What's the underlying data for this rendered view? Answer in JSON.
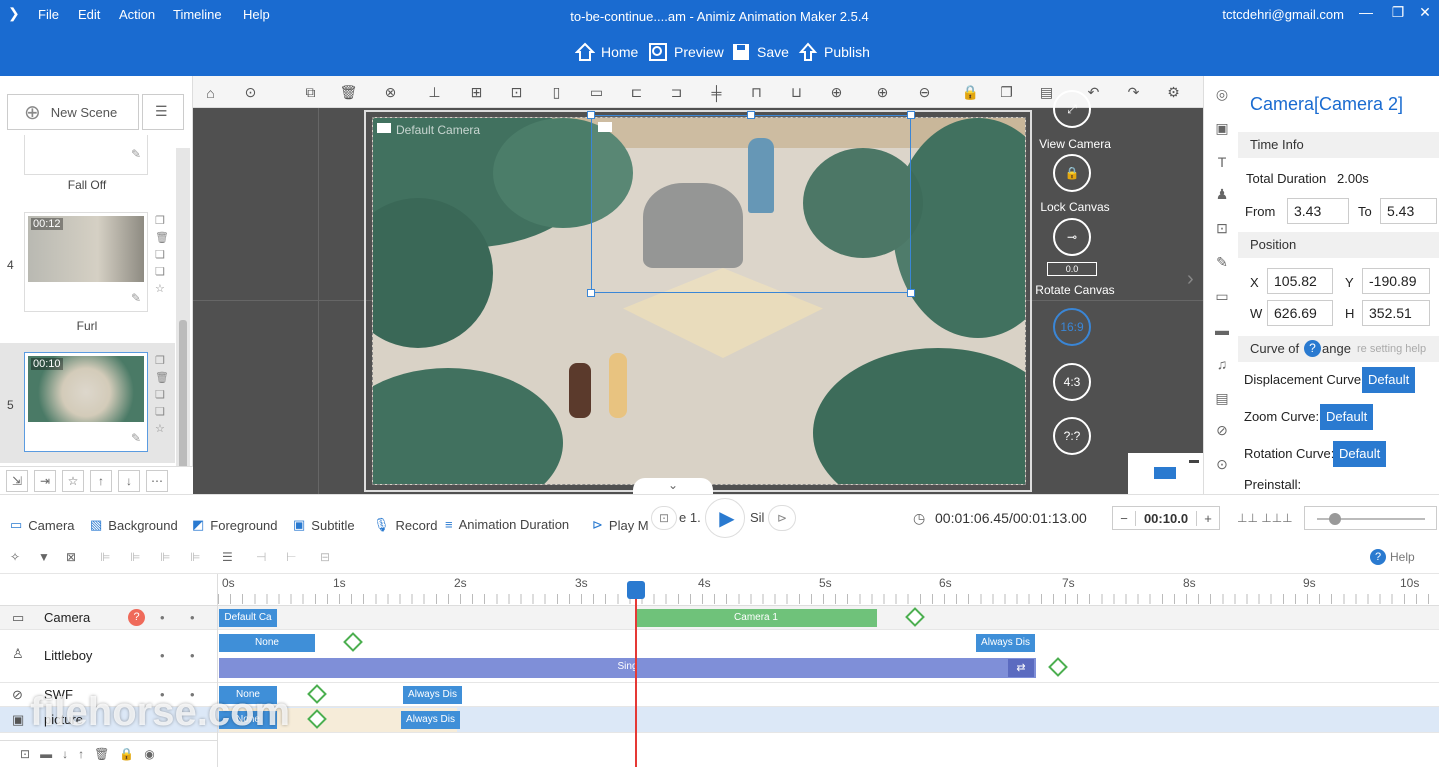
{
  "window": {
    "title": "to-be-continue....am - Animiz Animation Maker 2.5.4",
    "user": "tctcdehri@gmail.com"
  },
  "menu": [
    "File",
    "Edit",
    "Action",
    "Timeline",
    "Help"
  ],
  "top_actions": {
    "home": "Home",
    "preview": "Preview",
    "save": "Save",
    "publish": "Publish"
  },
  "scenes": {
    "new_scene": "New Scene",
    "items": [
      {
        "number": "",
        "name": "Fall Off",
        "time": ""
      },
      {
        "number": "4",
        "name": "Furl",
        "time": "00:12"
      },
      {
        "number": "5",
        "name": "",
        "time": "00:10"
      }
    ]
  },
  "canvas": {
    "default_camera_label": "Default Camera"
  },
  "canvas_controls": {
    "view_camera": "View Camera",
    "lock_canvas": "Lock Canvas",
    "rotate_value": "0.0",
    "rotate_canvas": "Rotate Canvas",
    "ratio_16_9": "16:9",
    "ratio_4_3": "4:3",
    "ratio_custom": "?:?"
  },
  "properties": {
    "title": "Camera[Camera 2]",
    "time_info": "Time Info",
    "total_duration_label": "Total Duration",
    "total_duration": "2.00s",
    "from_label": "From",
    "from": "3.43",
    "to_label": "To",
    "to": "5.43",
    "position": "Position",
    "x_label": "X",
    "x": "105.82",
    "y_label": "Y",
    "y": "-190.89",
    "w_label": "W",
    "w": "626.69",
    "h_label": "H",
    "h": "352.51",
    "curve_label": "Curve of",
    "curve_label_end": "ange",
    "curve_help": "re setting help",
    "displacement_curve": "Displacement Curve:",
    "zoom_curve": "Zoom Curve:",
    "rotation_curve": "Rotation Curve:",
    "default_btn": "Default",
    "preinstall": "Preinstall:"
  },
  "timeline_toolbar": {
    "camera": "Camera",
    "background": "Background",
    "foreground": "Foreground",
    "subtitle": "Subtitle",
    "record": "Record",
    "animation_duration": "Animation Duration",
    "play_mode": "Play M",
    "play_mode_end": "e 1.",
    "sil": "Sil",
    "timecode": "00:01:06.45/00:01:13.00",
    "zoom": "00:10.0",
    "help": "Help"
  },
  "ruler": [
    "0s",
    "1s",
    "2s",
    "3s",
    "4s",
    "5s",
    "6s",
    "7s",
    "8s",
    "9s",
    "10s"
  ],
  "tracks": [
    {
      "name": "Camera",
      "bars": [
        {
          "label": "Default Ca"
        },
        {
          "label": "Camera 1"
        }
      ]
    },
    {
      "name": "Littleboy",
      "bars": [
        {
          "label": "None"
        },
        {
          "label": "Always Dis"
        },
        {
          "label": "Sing"
        }
      ]
    },
    {
      "name": "SWF",
      "bars": [
        {
          "label": "None"
        },
        {
          "label": "Always Dis"
        }
      ]
    },
    {
      "name": "picture",
      "bars": [
        {
          "label": "None"
        },
        {
          "label": "Always Dis"
        }
      ]
    }
  ],
  "watermark": "filehorse.com",
  "colors": {
    "accent": "#1a6bd0",
    "keyframe": "#4caf50",
    "playhead": "#e53935"
  }
}
